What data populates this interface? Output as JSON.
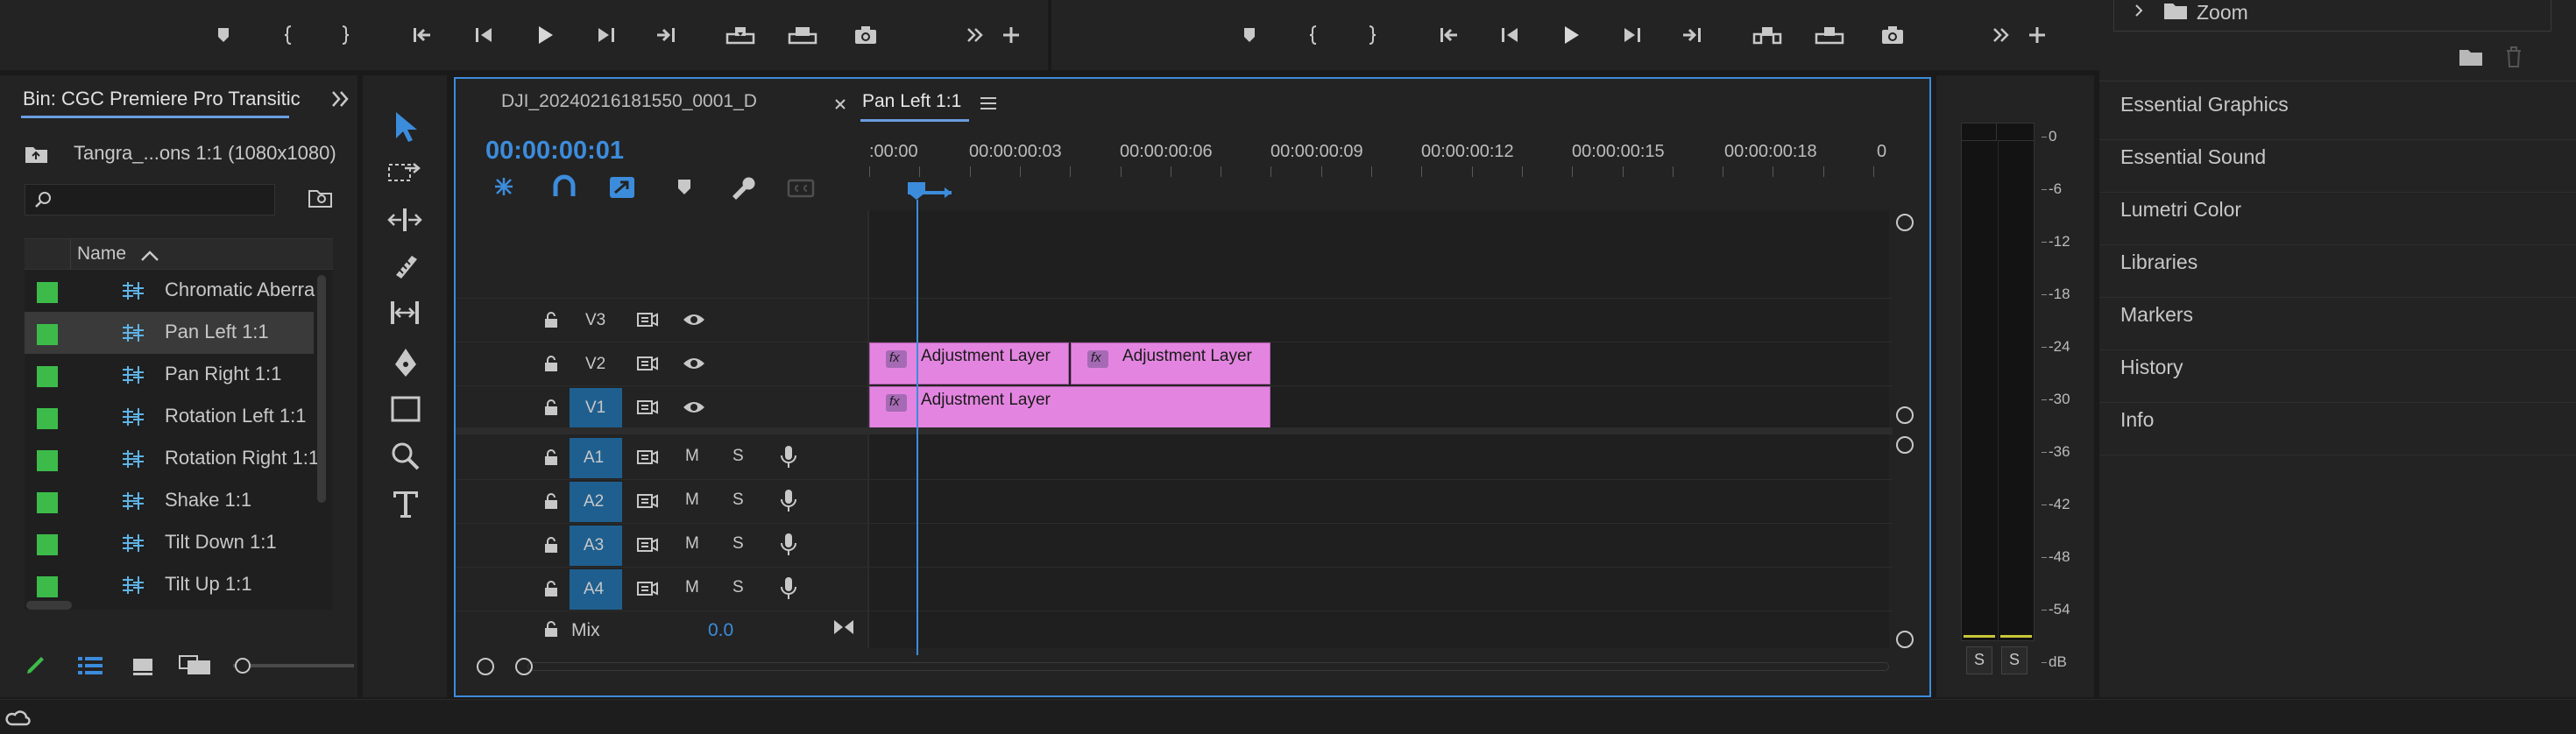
{
  "bin": {
    "title": "Bin: CGC Premiere Pro Transitic",
    "breadcrumb": "Tangra_...ons 1:1 (1080x1080)",
    "search_placeholder": "",
    "column_name": "Name",
    "items": [
      {
        "label": "Chromatic Aberra",
        "color": "#3dbb4a"
      },
      {
        "label": "Pan Left 1:1",
        "color": "#3dbb4a"
      },
      {
        "label": "Pan Right 1:1",
        "color": "#3dbb4a"
      },
      {
        "label": "Rotation Left 1:1",
        "color": "#3dbb4a"
      },
      {
        "label": "Rotation Right 1:1",
        "color": "#3dbb4a"
      },
      {
        "label": "Shake 1:1",
        "color": "#3dbb4a"
      },
      {
        "label": "Tilt Down 1:1",
        "color": "#3dbb4a"
      },
      {
        "label": "Tilt Up 1:1",
        "color": "#3dbb4a"
      }
    ]
  },
  "timeline": {
    "tab_inactive": "DJI_20240216181550_0001_D",
    "tab_active": "Pan Left 1:1",
    "timecode": "00:00:00:01",
    "ruler": [
      ":00:00",
      "00:00:00:03",
      "00:00:00:06",
      "00:00:00:09",
      "00:00:00:12",
      "00:00:00:15",
      "00:00:00:18",
      "0"
    ],
    "video_tracks": [
      {
        "name": "V3",
        "target": false
      },
      {
        "name": "V2",
        "target": false
      },
      {
        "name": "V1",
        "target": true
      }
    ],
    "audio_tracks": [
      {
        "name": "A1",
        "m": "M",
        "s": "S"
      },
      {
        "name": "A2",
        "m": "M",
        "s": "S"
      },
      {
        "name": "A3",
        "m": "M",
        "s": "S"
      },
      {
        "name": "A4",
        "m": "M",
        "s": "S"
      }
    ],
    "mix_label": "Mix",
    "mix_value": "0.0",
    "clips": {
      "v2_a": "Adjustment Layer",
      "v2_b": "Adjustment Layer",
      "v1": "Adjustment Layer",
      "fx": "fx"
    },
    "clip_color": "#e385e0",
    "accent": "#3c8cdc"
  },
  "meter": {
    "scale": [
      "0",
      "-6",
      "-12",
      "-18",
      "-24",
      "-30",
      "-36",
      "-42",
      "-48",
      "-54",
      "dB"
    ],
    "solo_left": "S",
    "solo_right": "S"
  },
  "right_panel": {
    "zoom_label": "Zoom",
    "items": [
      "Essential Graphics",
      "Essential Sound",
      "Lumetri Color",
      "Libraries",
      "Markers",
      "History",
      "Info"
    ]
  }
}
